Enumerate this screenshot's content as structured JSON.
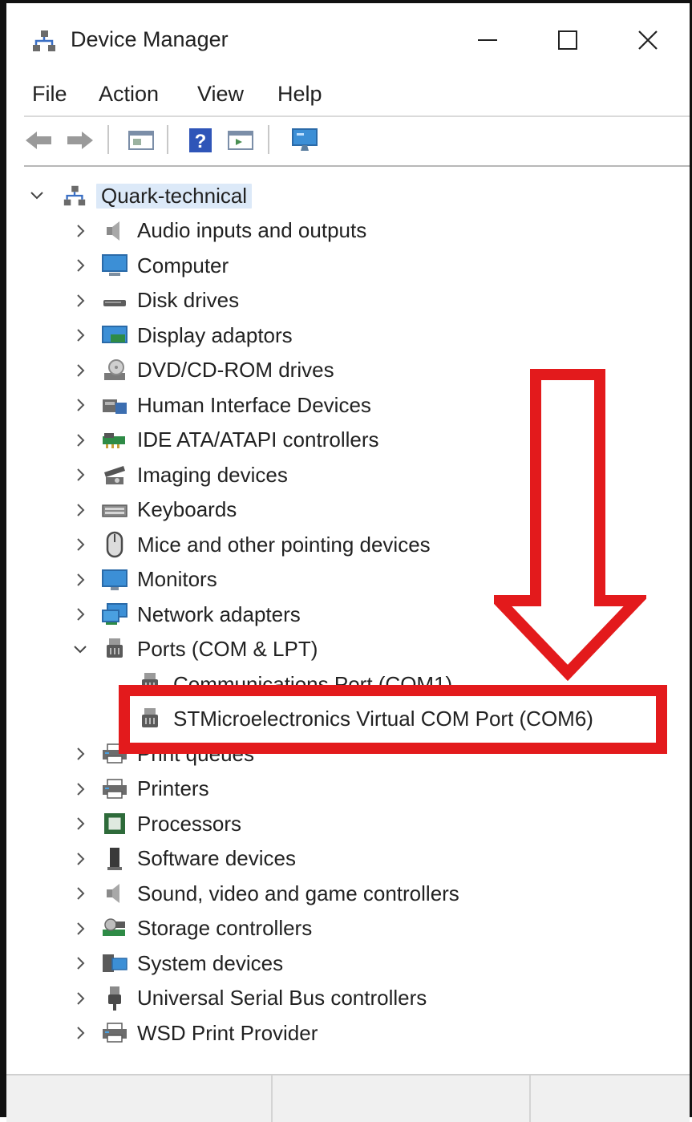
{
  "window": {
    "title": "Device Manager"
  },
  "window_controls": {
    "minimize": "—",
    "maximize": "☐",
    "close": "✕"
  },
  "menu": [
    "File",
    "Action",
    "View",
    "Help"
  ],
  "toolbar": [
    "back-icon",
    "forward-icon",
    "properties-icon",
    "help-icon",
    "update-driver-icon",
    "monitor-icon"
  ],
  "tree": {
    "root": "Quark-technical",
    "categories": [
      {
        "label": "Audio inputs and outputs",
        "icon": "speaker-icon"
      },
      {
        "label": "Computer",
        "icon": "computer-icon"
      },
      {
        "label": "Disk drives",
        "icon": "disk-drive-icon"
      },
      {
        "label": "Display adaptors",
        "icon": "display-adapter-icon"
      },
      {
        "label": "DVD/CD-ROM drives",
        "icon": "dvd-drive-icon"
      },
      {
        "label": "Human Interface Devices",
        "icon": "hid-icon"
      },
      {
        "label": "IDE ATA/ATAPI controllers",
        "icon": "ide-controller-icon"
      },
      {
        "label": "Imaging devices",
        "icon": "camera-icon"
      },
      {
        "label": "Keyboards",
        "icon": "keyboard-icon"
      },
      {
        "label": "Mice and other pointing devices",
        "icon": "mouse-icon"
      },
      {
        "label": "Monitors",
        "icon": "monitor-icon"
      },
      {
        "label": "Network adapters",
        "icon": "network-adapter-icon"
      },
      {
        "label": "Ports (COM & LPT)",
        "icon": "port-icon",
        "expanded": true
      },
      {
        "label": "Print queues",
        "icon": "printer-icon"
      },
      {
        "label": "Printers",
        "icon": "printer-icon"
      },
      {
        "label": "Processors",
        "icon": "processor-icon"
      },
      {
        "label": "Software devices",
        "icon": "software-device-icon"
      },
      {
        "label": "Sound, video and game controllers",
        "icon": "speaker-icon"
      },
      {
        "label": "Storage controllers",
        "icon": "storage-controller-icon"
      },
      {
        "label": "System devices",
        "icon": "system-device-icon"
      },
      {
        "label": "Universal Serial Bus controllers",
        "icon": "usb-icon"
      },
      {
        "label": "WSD Print Provider",
        "icon": "printer-icon"
      }
    ],
    "ports_children": [
      "Communications Port (COM1)",
      "STMicroelectronics Virtual COM Port (COM6)"
    ]
  },
  "annotation": {
    "color": "#e31a1c",
    "highlighted_item": "STMicroelectronics Virtual COM Port (COM6)"
  }
}
